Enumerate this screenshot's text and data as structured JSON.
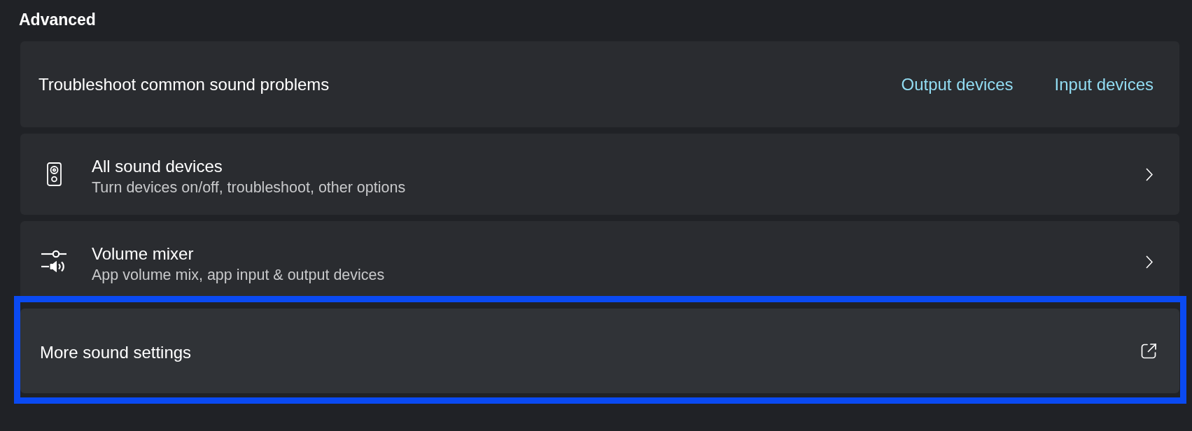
{
  "section": {
    "title": "Advanced"
  },
  "items": [
    {
      "kind": "links",
      "label": "Troubleshoot common sound problems",
      "links": [
        "Output devices",
        "Input devices"
      ],
      "highlighted": false
    },
    {
      "kind": "nav",
      "label": "All sound devices",
      "description": "Turn devices on/off, troubleshoot, other options",
      "highlighted": false
    },
    {
      "kind": "nav",
      "label": "Volume mixer",
      "description": "App volume mix, app input & output devices",
      "highlighted": false
    },
    {
      "kind": "external",
      "label": "More sound settings",
      "highlighted": true
    }
  ]
}
